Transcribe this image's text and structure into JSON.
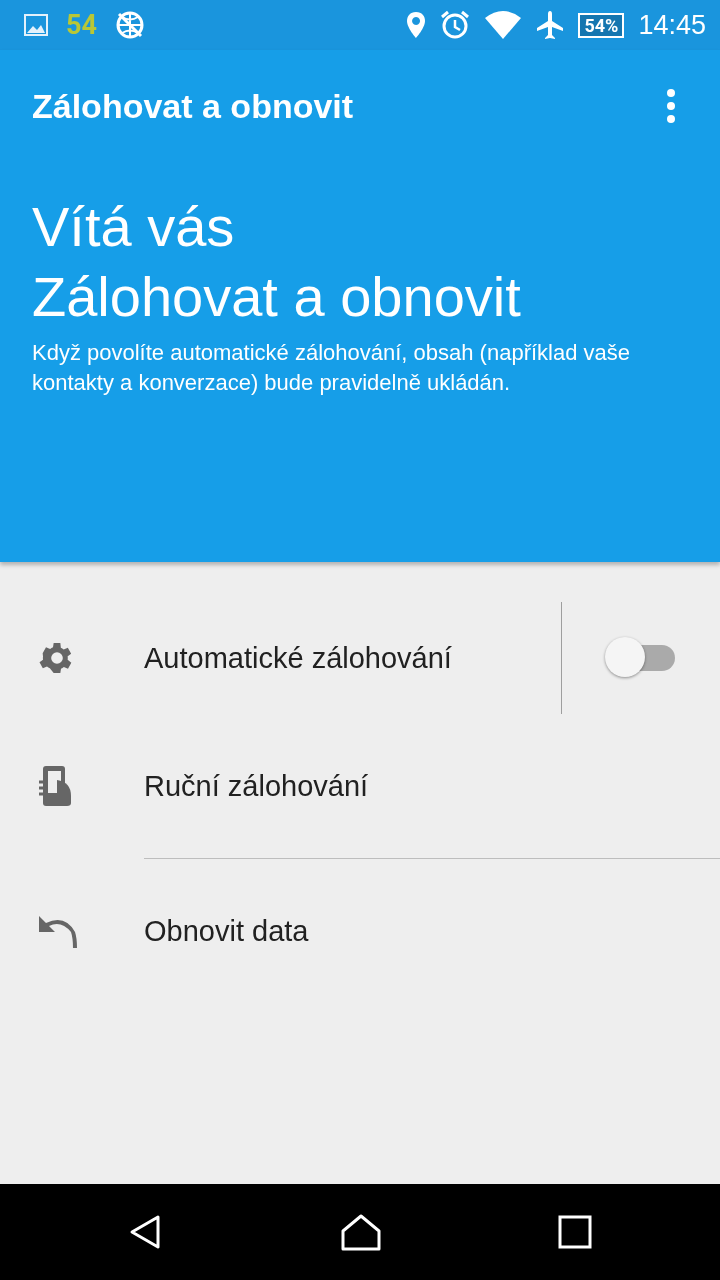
{
  "status_bar": {
    "notification_count": "54",
    "battery": "54%",
    "time": "14:45"
  },
  "app_bar": {
    "title": "Zálohovat a obnovit"
  },
  "header": {
    "heading_line_1": "Vítá vás",
    "heading_line_2": "Zálohovat a obnovit",
    "description": "Když povolíte automatické zálohování, obsah (například vaše kontakty a konverzace) bude pravidelně ukládán."
  },
  "items": [
    {
      "kind": "switch",
      "label": "Automatické zálohování",
      "on": false
    },
    {
      "kind": "plain",
      "label": "Ruční zálohování"
    },
    {
      "kind": "plain",
      "label": "Obnovit data"
    }
  ]
}
